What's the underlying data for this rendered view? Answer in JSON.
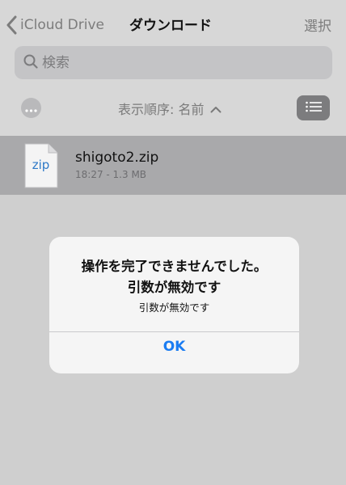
{
  "nav": {
    "back_label": "iCloud Drive",
    "title": "ダウンロード",
    "select_label": "選択"
  },
  "search": {
    "placeholder": "検索",
    "value": "",
    "icon": "search-icon"
  },
  "toolbar": {
    "more_icon": "more-icon",
    "sort_label": "表示順序: 名前",
    "sort_icon": "chevron-up-icon",
    "view_icon": "list-view-icon"
  },
  "files": [
    {
      "name": "shigoto2.zip",
      "meta": "18:27 - 1.3 MB",
      "icon_label": "zip",
      "icon": "zip-file-icon"
    }
  ],
  "alert": {
    "title_line1": "操作を完了できませんでした。",
    "title_line2": "引数が無効です",
    "message": "引数が無効です",
    "ok_label": "OK"
  },
  "colors": {
    "accent": "#1a7cf2",
    "selected_row": "#a9a9ab",
    "dimmed_bg": "#cfcfcf",
    "file_icon_text": "#2e79c7"
  }
}
